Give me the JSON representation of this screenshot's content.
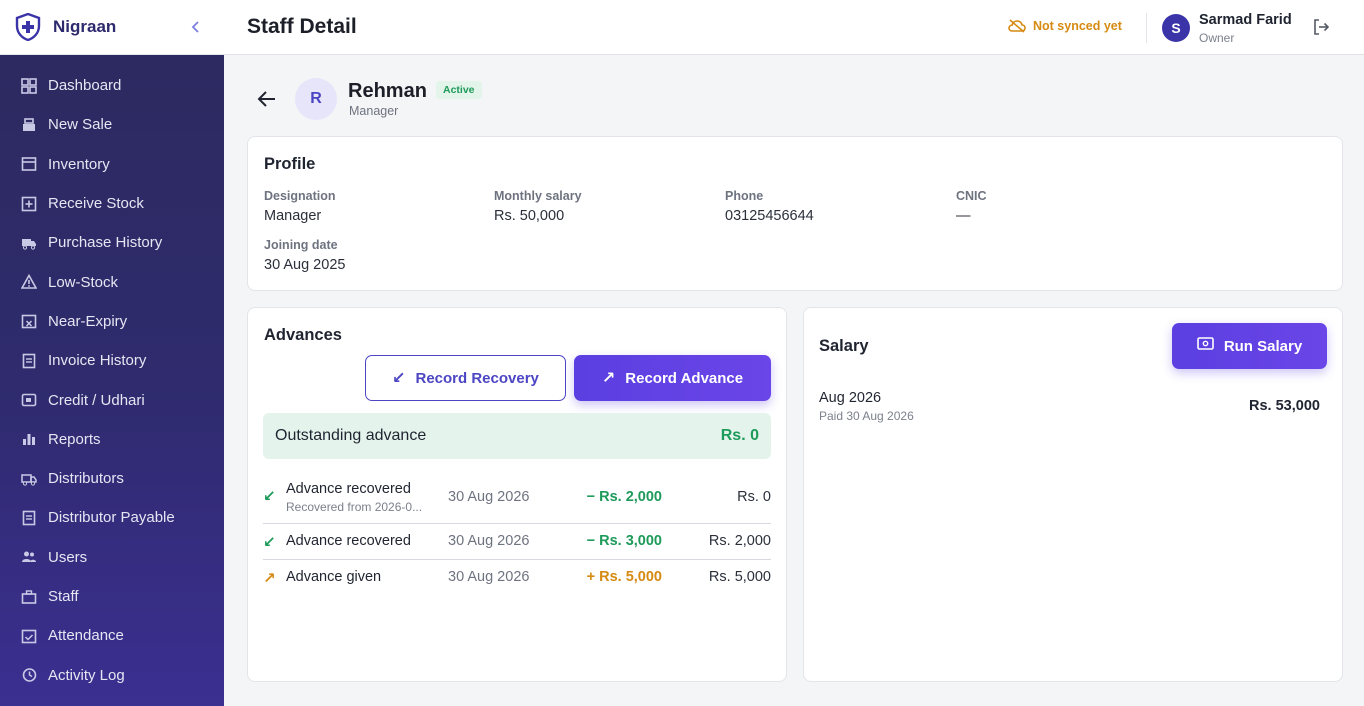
{
  "app": {
    "name": "Nigraan",
    "collapse_icon": "chevron-left-icon"
  },
  "sidebar": {
    "items": [
      {
        "label": "Dashboard",
        "icon": "dashboard-icon"
      },
      {
        "label": "New Sale",
        "icon": "register-icon"
      },
      {
        "label": "Inventory",
        "icon": "box-icon"
      },
      {
        "label": "Receive Stock",
        "icon": "plus-box-icon"
      },
      {
        "label": "Purchase History",
        "icon": "truck-icon"
      },
      {
        "label": "Low-Stock",
        "icon": "warning-icon"
      },
      {
        "label": "Near-Expiry",
        "icon": "calendar-x-icon"
      },
      {
        "label": "Invoice History",
        "icon": "document-icon"
      },
      {
        "label": "Credit / Udhari",
        "icon": "wallet-icon"
      },
      {
        "label": "Reports",
        "icon": "bar-chart-icon"
      },
      {
        "label": "Distributors",
        "icon": "truck-icon"
      },
      {
        "label": "Distributor Payable",
        "icon": "document-icon"
      },
      {
        "label": "Users",
        "icon": "users-icon"
      },
      {
        "label": "Staff",
        "icon": "briefcase-icon"
      },
      {
        "label": "Attendance",
        "icon": "calendar-check-icon"
      },
      {
        "label": "Activity Log",
        "icon": "history-icon"
      }
    ]
  },
  "header": {
    "title": "Staff Detail",
    "sync_status": "Not synced yet",
    "user": {
      "initial": "S",
      "name": "Sarmad Farid",
      "role": "Owner"
    }
  },
  "staff": {
    "initial": "R",
    "name": "Rehman",
    "status": "Active",
    "role": "Manager"
  },
  "profile": {
    "title": "Profile",
    "designation_label": "Designation",
    "designation": "Manager",
    "salary_label": "Monthly salary",
    "salary": "Rs. 50,000",
    "phone_label": "Phone",
    "phone": "03125456644",
    "cnic_label": "CNIC",
    "cnic": "—",
    "joining_label": "Joining date",
    "joining": "30 Aug 2025"
  },
  "advances": {
    "title": "Advances",
    "recovery_button": "Record Recovery",
    "advance_button": "Record Advance",
    "outstanding_label": "Outstanding advance",
    "outstanding_value": "Rs. 0",
    "rows": [
      {
        "title": "Advance recovered",
        "sub": "Recovered from 2026-0...",
        "date": "30 Aug 2026",
        "amount": "− Rs. 2,000",
        "balance": "Rs. 0"
      },
      {
        "title": "Advance recovered",
        "date": "30 Aug 2026",
        "amount": "− Rs. 3,000",
        "balance": "Rs. 2,000"
      },
      {
        "title": "Advance given",
        "date": "30 Aug 2026",
        "amount": "+ Rs. 5,000",
        "balance": "Rs. 5,000"
      }
    ]
  },
  "salary": {
    "title": "Salary",
    "run_button": "Run Salary",
    "entries": [
      {
        "month": "Aug 2026",
        "paid": "Paid 30 Aug 2026",
        "amount": "Rs. 53,000"
      }
    ]
  }
}
